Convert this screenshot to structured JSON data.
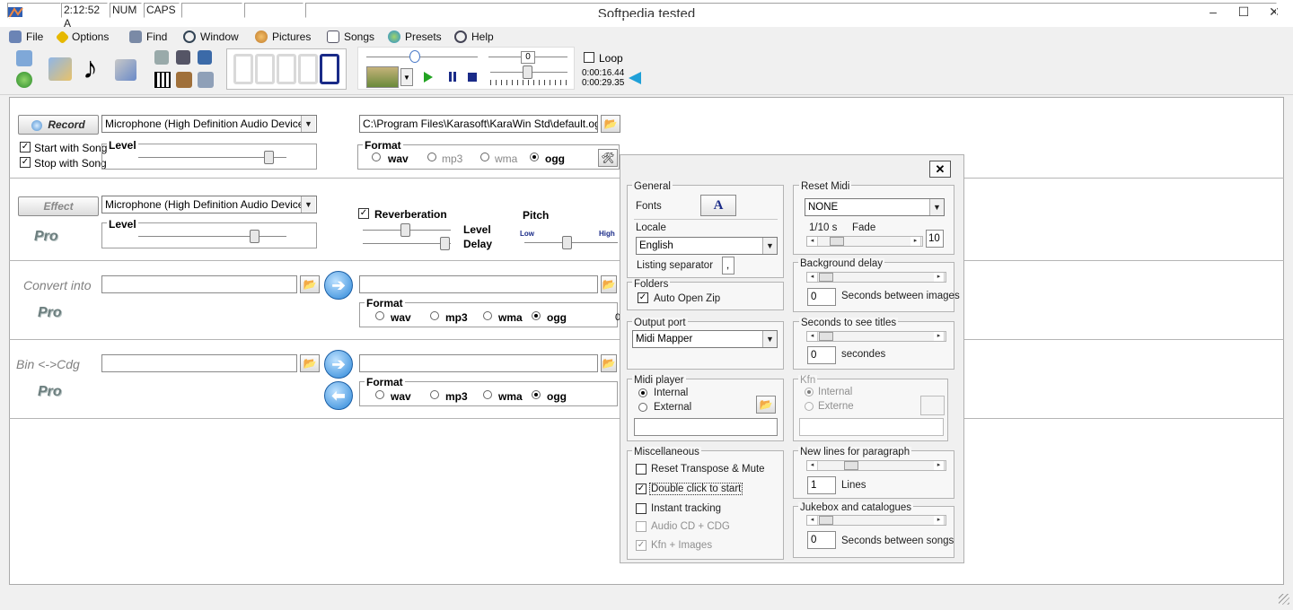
{
  "window": {
    "title": "Softpedia tested",
    "controls": [
      "–",
      "☐",
      "✕"
    ]
  },
  "menu": [
    {
      "label": "File",
      "icon": "file-icon"
    },
    {
      "label": "Options",
      "icon": "options-icon"
    },
    {
      "label": "Find",
      "icon": "find-icon"
    },
    {
      "label": "Window",
      "icon": "window-icon"
    },
    {
      "label": "Pictures",
      "icon": "pictures-icon"
    },
    {
      "label": "Songs",
      "icon": "songs-icon"
    },
    {
      "label": "Presets",
      "icon": "presets-icon"
    },
    {
      "label": "Help",
      "icon": "help-icon"
    }
  ],
  "player": {
    "transpose_value": "0",
    "loop_label": "Loop",
    "elapsed": "0:00:16.44",
    "total": "0:00:29.35",
    "counter_digit": "0"
  },
  "record": {
    "button_label": "Record",
    "device": "Microphone (High Definition Audio Device)",
    "start_with_song": "Start with Song",
    "stop_with_song": "Stop with Song",
    "level_label": "Level",
    "level_value": 0.85,
    "output_path": "C:\\Program Files\\Karasoft\\KaraWin Std\\default.ogg",
    "format_label": "Format",
    "formats": [
      "wav",
      "mp3",
      "wma",
      "ogg"
    ],
    "selected_format": "ogg"
  },
  "effect": {
    "button_label": "Effect",
    "device": "Microphone (High Definition Audio Device)",
    "level_label": "Level",
    "level_value": 0.73,
    "pro_label": "Pro",
    "reverberation_label": "Reverberation",
    "rev_level_label": "Level",
    "rev_delay_label": "Delay",
    "pitch_label": "Pitch",
    "pitch_low": "Low",
    "pitch_high": "High"
  },
  "convert": {
    "label": "Convert into",
    "pro_label": "Pro",
    "format_label": "Format",
    "formats": [
      "wav",
      "mp3",
      "wma",
      "ogg"
    ],
    "selected_format": "ogg",
    "partial_text": "0"
  },
  "bincdg": {
    "label": "Bin <->Cdg",
    "pro_label": "Pro",
    "format_label": "Format",
    "formats": [
      "wav",
      "mp3",
      "wma",
      "ogg"
    ],
    "selected_format": "ogg"
  },
  "dialog": {
    "close": "✕",
    "general": {
      "title": "General",
      "fonts_label": "Fonts",
      "fonts_button": "A",
      "locale_label": "Locale",
      "locale_value": "English",
      "listing_separator_label": "Listing separator",
      "listing_separator_value": ","
    },
    "folders": {
      "title": "Folders",
      "auto_open_zip": "Auto Open Zip"
    },
    "output_port": {
      "title": "Output port",
      "value": "Midi Mapper"
    },
    "midi_player": {
      "title": "Midi player",
      "internal": "Internal",
      "external": "External"
    },
    "misc": {
      "title": "Miscellaneous",
      "reset_transpose": "Reset Transpose & Mute",
      "double_click": "Double click to start",
      "instant_tracking": "Instant tracking",
      "audio_cd": "Audio CD + CDG",
      "kfn_images": "Kfn + Images"
    },
    "reset_midi": {
      "title": "Reset Midi",
      "value": "NONE",
      "tenths_label": "1/10 s",
      "fade_label": "Fade",
      "fade_value": "10"
    },
    "background_delay": {
      "title": "Background delay",
      "value": "0",
      "unit": "Seconds between images"
    },
    "seconds_titles": {
      "title": "Seconds to see titles",
      "value": "0",
      "unit": "secondes"
    },
    "kfn": {
      "title": "Kfn",
      "internal": "Internal",
      "externe": "Externe"
    },
    "new_lines": {
      "title": "New lines for paragraph",
      "value": "1",
      "unit": "Lines"
    },
    "jukebox": {
      "title": "Jukebox and catalogues",
      "value": "0",
      "unit": "Seconds between songs"
    }
  },
  "status": {
    "time": "2:12:52 A",
    "num": "NUM",
    "caps": "CAPS"
  }
}
